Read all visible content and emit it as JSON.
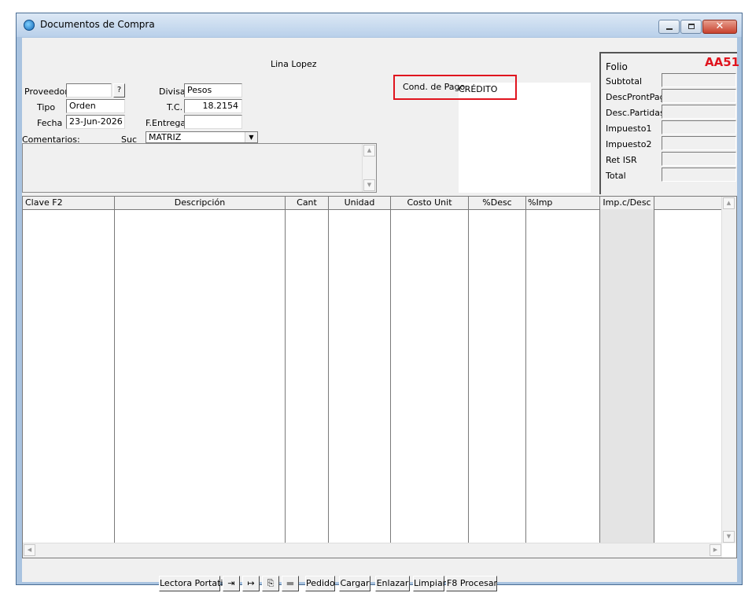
{
  "window": {
    "title": "Documentos de Compra"
  },
  "header": {
    "user_name": "Lina Lopez",
    "proveedor_label": "Proveedor",
    "proveedor_value": "",
    "proveedor_lookup_label": "?",
    "tipo_label": "Tipo",
    "tipo_value": "Orden",
    "fecha_label": "Fecha",
    "fecha_value": "23-Jun-2026",
    "divisa_label": "Divisa",
    "divisa_value": "Pesos",
    "tc_label": "T.C.",
    "tc_value": "18.2154",
    "fentrega_label": "F.Entrega",
    "fentrega_value": "",
    "comentarios_label": "Comentarios:",
    "suc_label": "Suc",
    "suc_value": "MATRIZ",
    "cond_pago_label": "Cond. de Pago",
    "cond_pago_value": "CRÉDITO"
  },
  "totals": {
    "folio_label": "Folio",
    "folio_value": "AA51",
    "rows": [
      {
        "label": "Subtotal",
        "value": ""
      },
      {
        "label": "DescProntPago",
        "value": ""
      },
      {
        "label": "Desc.Partidas",
        "value": ""
      },
      {
        "label": "Impuesto1",
        "value": ""
      },
      {
        "label": "Impuesto2",
        "value": ""
      },
      {
        "label": "Ret ISR",
        "value": ""
      },
      {
        "label": "Total",
        "value": ""
      }
    ]
  },
  "grid": {
    "columns": [
      "Clave  F2",
      "Descripción",
      "Cant",
      "Unidad",
      "Costo Unit",
      "%Desc",
      "%Imp",
      "Imp.c/Desc",
      ""
    ]
  },
  "toolbar": {
    "lectora_label": "Lectora Portatil",
    "pedido_label": "Pedido",
    "cargar_label": "Cargar",
    "enlazar_label": "Enlazar",
    "limpiar_label": "Limpiar",
    "procesar_label": "F8 Procesar",
    "icons": [
      "import-icon",
      "export-icon",
      "copy-icon",
      "folder-icon"
    ]
  },
  "colors": {
    "accent_red": "#e0141e",
    "title_bar": "#b9d0ea"
  }
}
